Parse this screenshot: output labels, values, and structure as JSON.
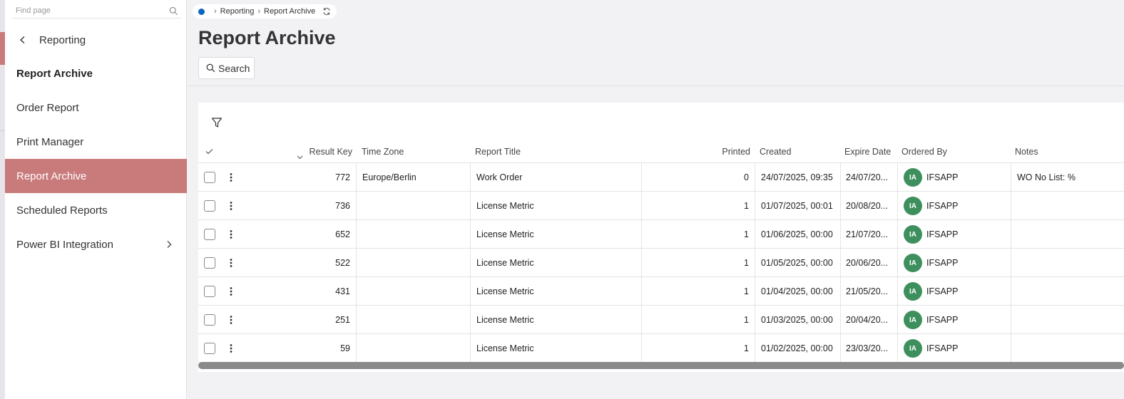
{
  "sidebar": {
    "search_placeholder": "Find page",
    "back_label": "Reporting",
    "heading": "Report Archive",
    "items": [
      {
        "label": "Order Report"
      },
      {
        "label": "Print Manager"
      },
      {
        "label": "Report Archive",
        "active": true
      },
      {
        "label": "Scheduled Reports"
      },
      {
        "label": "Power BI Integration",
        "has_submenu": true
      }
    ]
  },
  "breadcrumb": {
    "items": [
      "Reporting",
      "Report Archive"
    ],
    "icon": "refresh-icon"
  },
  "page": {
    "title": "Report Archive",
    "search_label": "Search"
  },
  "table": {
    "columns": {
      "result_key": "Result Key",
      "time_zone": "Time Zone",
      "report_title": "Report Title",
      "printed": "Printed",
      "created": "Created",
      "expire_date": "Expire Date",
      "ordered_by": "Ordered By",
      "notes": "Notes"
    },
    "rows": [
      {
        "result_key": "772",
        "time_zone": "Europe/Berlin",
        "report_title": "Work Order",
        "printed": "0",
        "created": "24/07/2025, 09:35",
        "expire_date": "24/07/20...",
        "avatar": "IA",
        "ordered_by": "IFSAPP",
        "notes": "WO No List: %"
      },
      {
        "result_key": "736",
        "time_zone": "",
        "report_title": "License Metric",
        "printed": "1",
        "created": "01/07/2025, 00:01",
        "expire_date": "20/08/20...",
        "avatar": "IA",
        "ordered_by": "IFSAPP",
        "notes": ""
      },
      {
        "result_key": "652",
        "time_zone": "",
        "report_title": "License Metric",
        "printed": "1",
        "created": "01/06/2025, 00:00",
        "expire_date": "21/07/20...",
        "avatar": "IA",
        "ordered_by": "IFSAPP",
        "notes": ""
      },
      {
        "result_key": "522",
        "time_zone": "",
        "report_title": "License Metric",
        "printed": "1",
        "created": "01/05/2025, 00:00",
        "expire_date": "20/06/20...",
        "avatar": "IA",
        "ordered_by": "IFSAPP",
        "notes": ""
      },
      {
        "result_key": "431",
        "time_zone": "",
        "report_title": "License Metric",
        "printed": "1",
        "created": "01/04/2025, 00:00",
        "expire_date": "21/05/20...",
        "avatar": "IA",
        "ordered_by": "IFSAPP",
        "notes": ""
      },
      {
        "result_key": "251",
        "time_zone": "",
        "report_title": "License Metric",
        "printed": "1",
        "created": "01/03/2025, 00:00",
        "expire_date": "20/04/20...",
        "avatar": "IA",
        "ordered_by": "IFSAPP",
        "notes": ""
      },
      {
        "result_key": "59",
        "time_zone": "",
        "report_title": "License Metric",
        "printed": "1",
        "created": "01/02/2025, 00:00",
        "expire_date": "23/03/20...",
        "avatar": "IA",
        "ordered_by": "IFSAPP",
        "notes": ""
      }
    ]
  },
  "colors": {
    "accent": "#c97a7a",
    "avatar": "#3e8f5e",
    "breadcrumb_dot": "#0a66c2"
  }
}
